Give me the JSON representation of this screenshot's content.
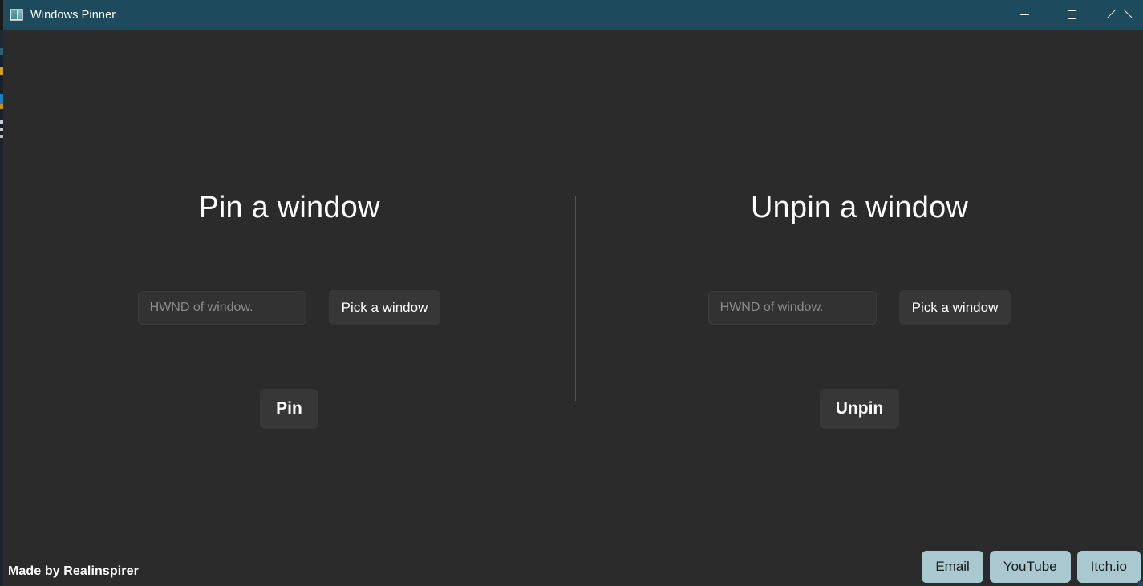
{
  "window": {
    "title": "Windows Pinner",
    "icon": "window-app-icon",
    "titlebar_color": "#1e4a5e",
    "body_color": "#2b2b2b",
    "controls": {
      "minimize": "minimize-icon",
      "maximize": "maximize-icon",
      "close": "close-icon"
    }
  },
  "panels": [
    {
      "id": "pin",
      "title": "Pin a window",
      "input": {
        "value": "",
        "placeholder": "HWND of window."
      },
      "pick_label": "Pick a window",
      "action_label": "Pin"
    },
    {
      "id": "unpin",
      "title": "Unpin a window",
      "input": {
        "value": "",
        "placeholder": "HWND of window."
      },
      "pick_label": "Pick a window",
      "action_label": "Unpin"
    }
  ],
  "footer": {
    "credit": "Made by Realinspirer",
    "links": [
      {
        "label": "Email"
      },
      {
        "label": "YouTube"
      },
      {
        "label": "Itch.io"
      }
    ],
    "link_color": "#a8c9cf"
  }
}
